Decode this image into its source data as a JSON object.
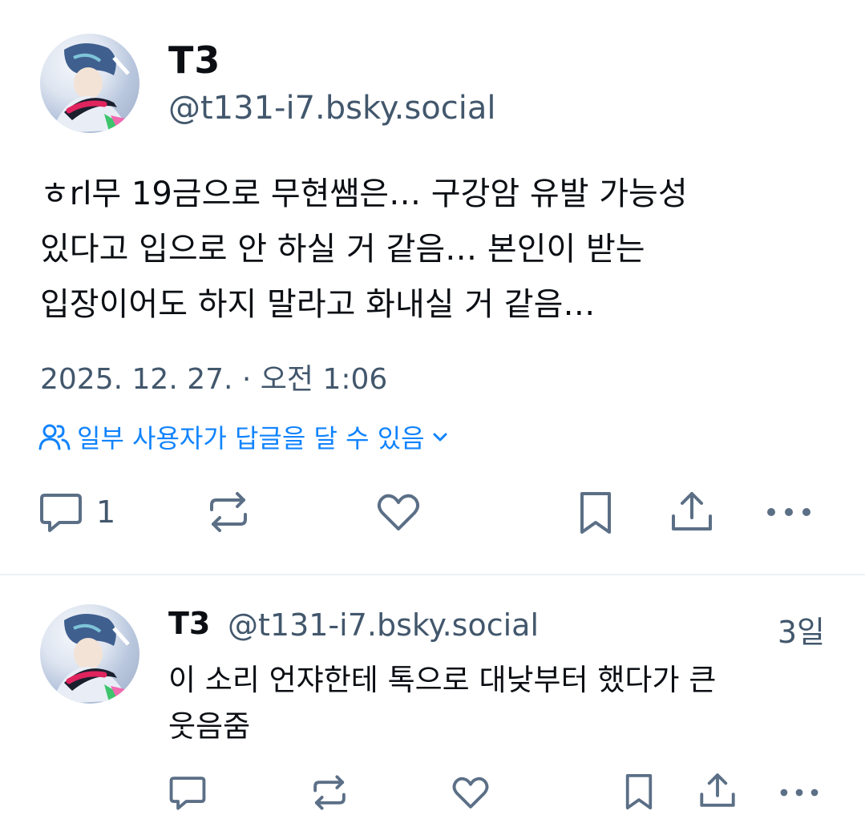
{
  "post": {
    "author_name": "T3",
    "author_handle": "@t131-i7.bsky.social",
    "text": "ㅎrl무 19금으로 무현쌤은… 구강암 유발 가능성\n있다고 입으로 안 하실 거 같음… 본인이 받는\n입장이어도 하지 말라고 화내실 거 같음…",
    "timestamp": "2025. 12. 27. · 오전 1:06",
    "reply_setting": "일부 사용자가 답글을 달 수 있음",
    "reply_count": "1"
  },
  "reply": {
    "author_name": "T3",
    "author_handle": "@t131-i7.bsky.social",
    "age": "3일",
    "text": "이 소리 언쟈한테 톡으로 대낮부터 했다가 큰\n웃음줌"
  },
  "icons": {
    "reply": "comment-bubble-icon",
    "repost": "repost-arrows-icon",
    "like": "heart-icon",
    "bookmark": "bookmark-icon",
    "share": "share-upload-icon",
    "more": "more-dots-icon",
    "people": "people-icon",
    "chevron": "chevron-down-icon"
  },
  "colors": {
    "accent": "#1083fe",
    "secondary_text": "#42576c",
    "icon": "#5b6f86",
    "divider": "#eef1f5"
  }
}
